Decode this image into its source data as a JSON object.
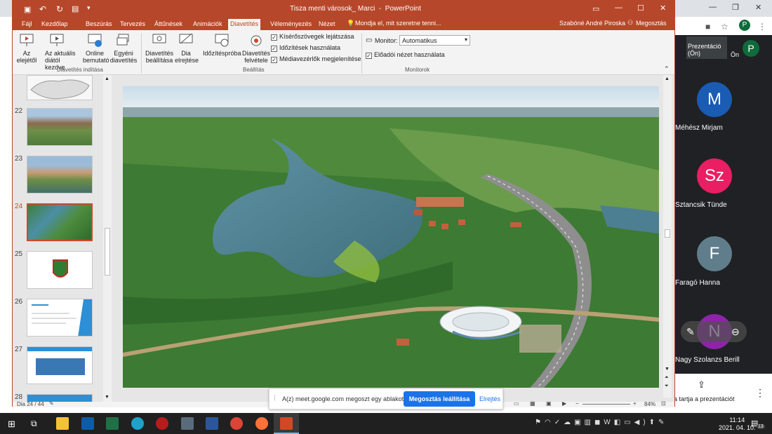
{
  "meet": {
    "tab_label_line1": "Prezentáció",
    "tab_label_line2": "(Ön)",
    "self_label": "Ön",
    "self_initial": "P",
    "participants": [
      {
        "initial": "M",
        "name": "Méhész Mirjam",
        "color": "#1a5bb3"
      },
      {
        "initial": "Sz",
        "name": "Sztancsik Tünde",
        "color": "#e91e63"
      },
      {
        "initial": "F",
        "name": "Faragó Hanna",
        "color": "#607d8b"
      },
      {
        "initial": "N",
        "name": "Nagy Szolanzs Berill",
        "color": "#8e24aa"
      }
    ],
    "share_text": "a tartja a prezentációt"
  },
  "ppt": {
    "title": "Tisza menti városok_ Marci  -  PowerPoint",
    "tabs": [
      "Fájl",
      "Kezdőlap",
      "Beszúrás",
      "Tervezés",
      "Áttűnések",
      "Animációk",
      "Diavetítés",
      "Véleményezés",
      "Nézet"
    ],
    "active_tab": "Diavetítés",
    "tell_me": "Mondja el, mit szeretne tenni...",
    "user": "Szabóné André Piroska",
    "share": "Megosztás",
    "ribbon": {
      "from_start": "Az elejétől",
      "from_current": "Az aktuális diától kezdve",
      "online": "Online bemutató",
      "custom": "Egyéni diavetítés",
      "group1": "Diavetítés indítása",
      "setup": "Diavetítés beállítása",
      "hide": "Dia elrejtése",
      "rehearse": "Időzítéspróba",
      "record": "Diavetítés felvétele",
      "play_narrations": "Kísérőszövegek lejátszása",
      "use_timings": "Időzítések használata",
      "show_media": "Médiavezérlők megjelenítése",
      "group2": "Beállítás",
      "monitor_label": "Monitor:",
      "monitor_value": "Automatikus",
      "presenter_view": "Előadói nézet használata",
      "group3": "Monitorok"
    },
    "slides": [
      "22",
      "23",
      "24",
      "25",
      "26",
      "27",
      "28"
    ],
    "current_slide": "24",
    "status_slide": "Dia 24 / 44",
    "zoom": "84%"
  },
  "notification": {
    "text": "A(z) meet.google.com megoszt egy ablakot.",
    "stop_button": "Megosztás leállítása",
    "hide_button": "Elrejtés"
  },
  "taskbar": {
    "time": "11:14",
    "date": "2021. 04. 10.",
    "notif_count": "13"
  }
}
